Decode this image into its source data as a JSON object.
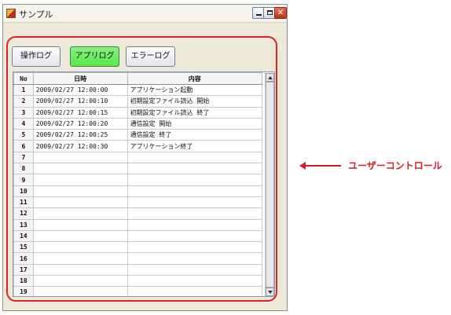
{
  "window": {
    "title": "サンプル",
    "controls": {
      "minimize": "minimize",
      "maximize": "maximize",
      "close": "✕"
    }
  },
  "tabs": {
    "operation_log": "操作ログ",
    "application_log": "アプリログ",
    "error_log": "エラーログ"
  },
  "grid": {
    "columns": [
      "No",
      "日時",
      "内容"
    ],
    "rows": [
      {
        "no": "1",
        "datetime": "2009/02/27 12:00:00",
        "content": "アプリケーション起動"
      },
      {
        "no": "2",
        "datetime": "2009/02/27 12:00:10",
        "content": "初期設定ファイル読込 開始"
      },
      {
        "no": "3",
        "datetime": "2009/02/27 12:00:15",
        "content": "初期設定ファイル読込 終了"
      },
      {
        "no": "4",
        "datetime": "2009/02/27 12:00:20",
        "content": "通信設定 開始"
      },
      {
        "no": "5",
        "datetime": "2009/02/27 12:00:25",
        "content": "通信設定 終了"
      },
      {
        "no": "6",
        "datetime": "2009/02/27 12:00:30",
        "content": "アプリケーション終了"
      },
      {
        "no": "7",
        "datetime": "",
        "content": ""
      },
      {
        "no": "8",
        "datetime": "",
        "content": ""
      },
      {
        "no": "9",
        "datetime": "",
        "content": ""
      },
      {
        "no": "10",
        "datetime": "",
        "content": ""
      },
      {
        "no": "11",
        "datetime": "",
        "content": ""
      },
      {
        "no": "12",
        "datetime": "",
        "content": ""
      },
      {
        "no": "13",
        "datetime": "",
        "content": ""
      },
      {
        "no": "14",
        "datetime": "",
        "content": ""
      },
      {
        "no": "15",
        "datetime": "",
        "content": ""
      },
      {
        "no": "16",
        "datetime": "",
        "content": ""
      },
      {
        "no": "17",
        "datetime": "",
        "content": ""
      },
      {
        "no": "18",
        "datetime": "",
        "content": ""
      },
      {
        "no": "19",
        "datetime": "",
        "content": ""
      }
    ]
  },
  "annotation": {
    "label": "ユーザーコントロール",
    "color": "#d41c24"
  },
  "icons": {
    "app": "application-icon",
    "scroll_up": "scroll-up-icon",
    "scroll_down": "scroll-down-icon"
  }
}
